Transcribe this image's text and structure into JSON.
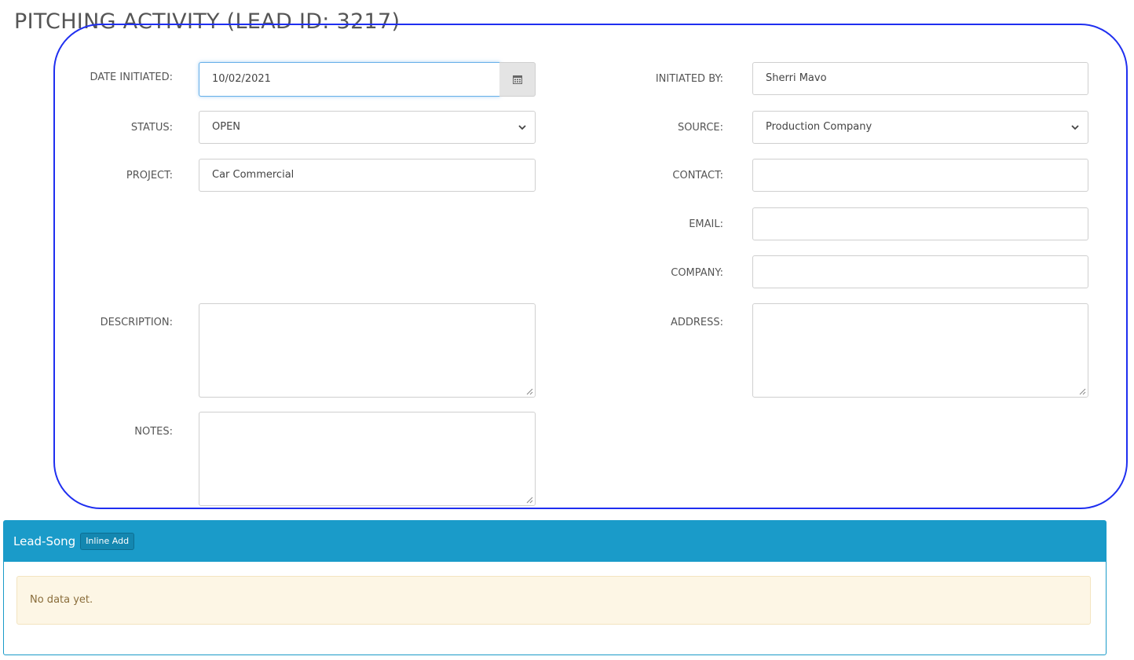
{
  "page": {
    "title": "PITCHING ACTIVITY (LEAD ID: 3217)"
  },
  "form": {
    "date_initiated": {
      "label": "DATE INITIATED:",
      "value": "10/02/2021"
    },
    "status": {
      "label": "STATUS:",
      "value": "OPEN"
    },
    "project": {
      "label": "PROJECT:",
      "value": "Car Commercial"
    },
    "description": {
      "label": "DESCRIPTION:",
      "value": ""
    },
    "notes": {
      "label": "NOTES:",
      "value": ""
    },
    "initiated_by": {
      "label": "INITIATED BY:",
      "value": "Sherri Mavo"
    },
    "source": {
      "label": "SOURCE:",
      "value": "Production Company"
    },
    "contact": {
      "label": "CONTACT:",
      "value": ""
    },
    "email": {
      "label": "EMAIL:",
      "value": ""
    },
    "company": {
      "label": "COMPANY:",
      "value": ""
    },
    "address": {
      "label": "ADDRESS:",
      "value": ""
    }
  },
  "lead_song_panel": {
    "title": "Lead-Song",
    "inline_add_label": "Inline Add",
    "empty_message": "No data yet."
  },
  "icons": {
    "date": "calendar-icon",
    "select": "chevron-down-icon",
    "textarea": "resize-grip-icon"
  },
  "colors": {
    "panel_accent": "#1a9bc9",
    "annotation_outline": "#1f2ff0",
    "alert_bg": "#fdf6e5",
    "alert_text": "#8a6d3b"
  }
}
